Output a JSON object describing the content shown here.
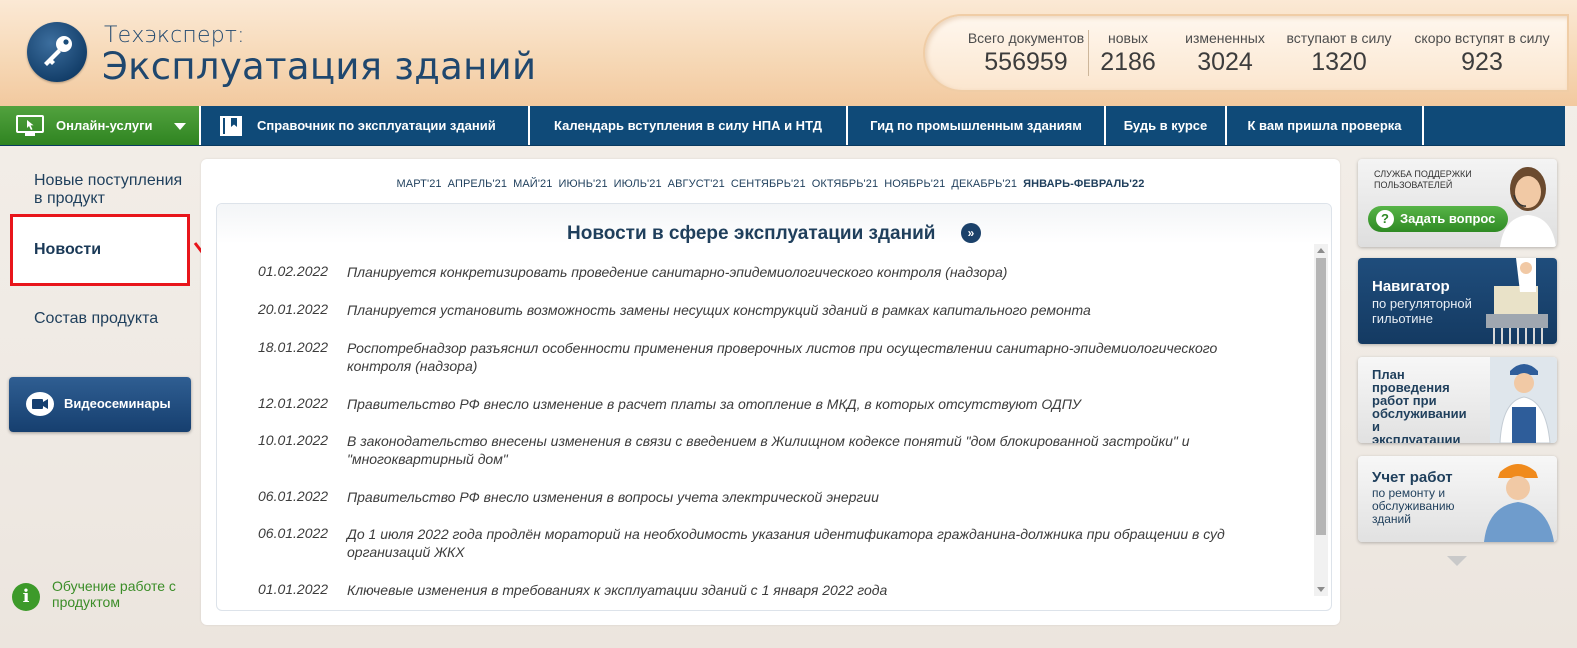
{
  "brand": {
    "line1": "Техэксперт:",
    "line2": "Эксплуатация зданий"
  },
  "stats": [
    {
      "label": "Всего документов",
      "value": "556959"
    },
    {
      "label": "новых",
      "value": "2186"
    },
    {
      "label": "измененных",
      "value": "3024"
    },
    {
      "label": "вступают в силу",
      "value": "1320"
    },
    {
      "label": "скоро вступят в силу",
      "value": "923"
    }
  ],
  "nav": {
    "online": "Онлайн-услуги",
    "items": [
      "Справочник по эксплуатации зданий",
      "Календарь вступления в силу НПА и НТД",
      "Гид по промышленным зданиям",
      "Будь в курсе",
      "К вам пришла проверка"
    ]
  },
  "sidebar": {
    "new_items": "Новые поступления в продукт",
    "news": "Новости",
    "composition": "Состав продукта",
    "video": "Видеосеминары",
    "learn": "Обучение работе с продуктом"
  },
  "months": [
    "МАРТ'21",
    "АПРЕЛЬ'21",
    "МАЙ'21",
    "ИЮНЬ'21",
    "ИЮЛЬ'21",
    "АВГУСТ'21",
    "СЕНТЯБРЬ'21",
    "ОКТЯБРЬ'21",
    "НОЯБРЬ'21",
    "ДЕКАБРЬ'21",
    "ЯНВАРЬ-ФЕВРАЛЬ'22"
  ],
  "news": {
    "title": "Новости в сфере эксплуатации зданий",
    "items": [
      {
        "date": "01.02.2022",
        "text": "Планируется конкретизировать проведение санитарно-эпидемиологического контроля (надзора)"
      },
      {
        "date": "20.01.2022",
        "text": "Планируется установить возможность замены несущих конструкций зданий в рамках капитального ремонта"
      },
      {
        "date": "18.01.2022",
        "text": "Роспотребнадзор разъяснил особенности применения проверочных листов при осуществлении санитарно-эпидемиологического контроля (надзора)"
      },
      {
        "date": "12.01.2022",
        "text": "Правительство РФ внесло изменение в расчет платы за отопление в МКД, в которых отсутствуют ОДПУ"
      },
      {
        "date": "10.01.2022",
        "text": "В законодательство внесены изменения в связи с введением в Жилищном кодексе понятий \"дом блокированной застройки\" и \"многоквартирный дом\""
      },
      {
        "date": "06.01.2022",
        "text": "Правительство РФ внесло изменения в вопросы учета электрической энергии"
      },
      {
        "date": "06.01.2022",
        "text": "До 1 июля 2022 года продлён мораторий на необходимость указания идентификатора гражданина-должника при обращении в суд организаций ЖКХ"
      },
      {
        "date": "01.01.2022",
        "text": "Ключевые изменения в требованиях к эксплуатации зданий с 1 января 2022 года"
      }
    ]
  },
  "banners": {
    "support": {
      "small": "Служба поддержки пользователей",
      "button": "Задать вопрос"
    },
    "navigator": {
      "title": "Навигатор",
      "subtitle": "по регуляторной гильотине"
    },
    "plan": {
      "text": "План проведения работ при обслуживании и эксплуатации зданий"
    },
    "account": {
      "title": "Учет работ",
      "subtitle": "по ремонту и обслуживанию зданий"
    }
  },
  "colors": {
    "nav_bg": "#0f4a78",
    "online_green": "#3d9a2a",
    "highlight_red": "#e8151b",
    "title_blue": "#1f3f5c"
  }
}
